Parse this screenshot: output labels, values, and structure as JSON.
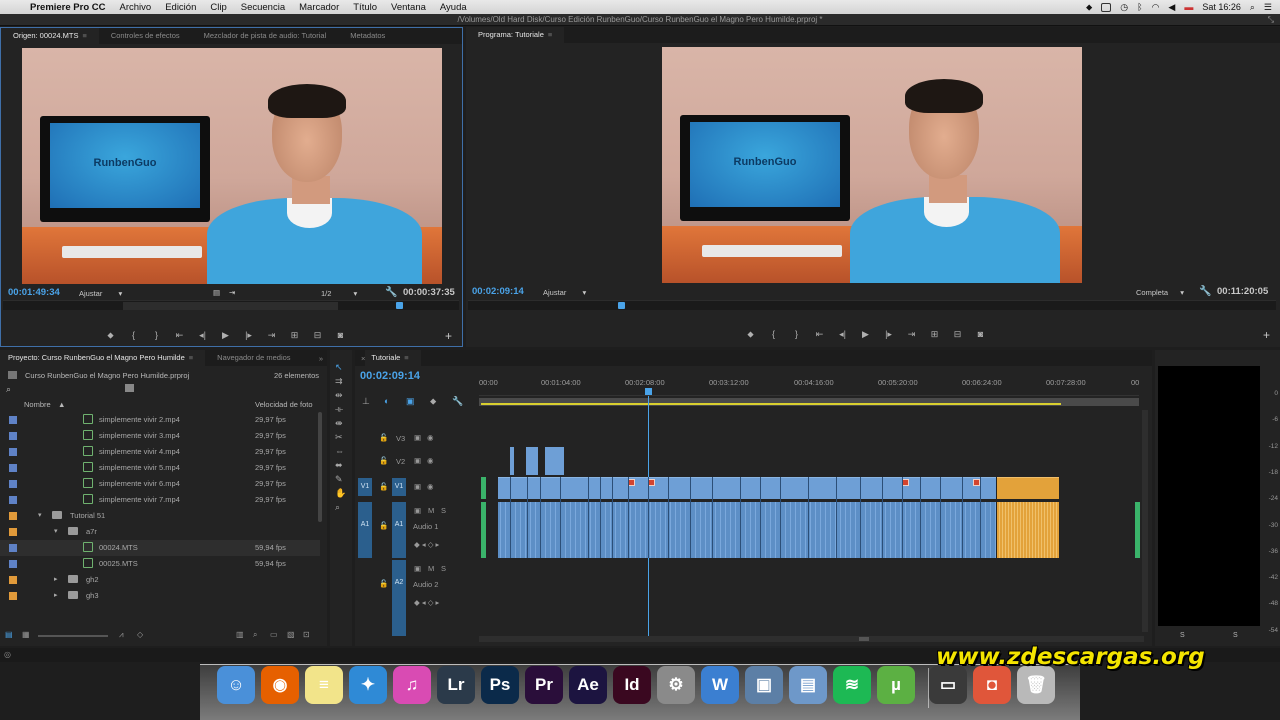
{
  "menubar": {
    "app": "Premiere Pro CC",
    "items": [
      "Archivo",
      "Edición",
      "Clip",
      "Secuencia",
      "Marcador",
      "Título",
      "Ventana",
      "Ayuda"
    ],
    "clock": "Sat 16:26"
  },
  "window": {
    "path": "/Volumes/Old Hard Disk/Curso Edición RunbenGuo/Curso RunbenGuo el Magno Pero Humilde.prproj *"
  },
  "source_monitor": {
    "tabs": [
      "Origen: 00024.MTS",
      "Controles de efectos",
      "Mezclador de pista de audio: Tutorial",
      "Metadatos"
    ],
    "screen_logo": "RunbenGuo",
    "timecode": "00:01:49:34",
    "fit": "Ajustar",
    "resolution": "1/2",
    "duration": "00:00:37:35"
  },
  "program_monitor": {
    "tab": "Programa: Tutoriale",
    "screen_logo": "RunbenGuo",
    "timecode": "00:02:09:14",
    "fit": "Ajustar",
    "quality": "Completa",
    "duration": "00:11:20:05"
  },
  "project": {
    "tabs": [
      "Proyecto: Curso RunbenGuo el Magno Pero Humilde",
      "Navegador de medios"
    ],
    "file": "Curso RunbenGuo el Magno Pero Humilde.prproj",
    "count": "26 elementos",
    "col_name": "Nombre",
    "col_fps": "Velocidad de foto",
    "rows": [
      {
        "name": "simplemente vivir 2.mp4",
        "fps": "29,97 fps",
        "indent": 3,
        "kind": "file",
        "label": "#5f82c6"
      },
      {
        "name": "simplemente vivir 3.mp4",
        "fps": "29,97 fps",
        "indent": 3,
        "kind": "file",
        "label": "#5f82c6"
      },
      {
        "name": "simplemente vivir 4.mp4",
        "fps": "29,97 fps",
        "indent": 3,
        "kind": "file",
        "label": "#5f82c6"
      },
      {
        "name": "simplemente vivir 5.mp4",
        "fps": "29,97 fps",
        "indent": 3,
        "kind": "file",
        "label": "#5f82c6"
      },
      {
        "name": "simplemente vivir 6.mp4",
        "fps": "29,97 fps",
        "indent": 3,
        "kind": "file",
        "label": "#5f82c6"
      },
      {
        "name": "simplemente vivir 7.mp4",
        "fps": "29,97 fps",
        "indent": 3,
        "kind": "file",
        "label": "#5f82c6"
      },
      {
        "name": "Tutorial 51",
        "fps": "",
        "indent": 1,
        "kind": "folder-open",
        "label": "#e19a3a"
      },
      {
        "name": "a7r",
        "fps": "",
        "indent": 2,
        "kind": "folder-open",
        "label": "#e19a3a"
      },
      {
        "name": "00024.MTS",
        "fps": "59,94 fps",
        "indent": 3,
        "kind": "file",
        "label": "#5f82c6"
      },
      {
        "name": "00025.MTS",
        "fps": "59,94 fps",
        "indent": 3,
        "kind": "file",
        "label": "#5f82c6"
      },
      {
        "name": "gh2",
        "fps": "",
        "indent": 2,
        "kind": "folder",
        "label": "#e19a3a"
      },
      {
        "name": "gh3",
        "fps": "",
        "indent": 2,
        "kind": "folder",
        "label": "#e19a3a"
      }
    ]
  },
  "timeline": {
    "tab": "Tutoriale",
    "timecode": "00:02:09:14",
    "ruler": [
      "00:00",
      "00:01:04:00",
      "00:02:08:00",
      "00:03:12:00",
      "00:04:16:00",
      "00:05:20:00",
      "00:06:24:00",
      "00:07:28:00",
      "00"
    ],
    "tracks": {
      "v3": "V3",
      "v2": "V2",
      "v1": "V1",
      "v1_src": "V1",
      "a1": "A1",
      "a1_src": "A1",
      "a1_name": "Audio 1",
      "a2": "A2",
      "a2_name": "Audio 2",
      "m": "M",
      "s": "S"
    }
  },
  "meters": {
    "scale": [
      "0",
      "-6",
      "-12",
      "-18",
      "-24",
      "-30",
      "-36",
      "-42",
      "-48",
      "-54"
    ],
    "solo": [
      "S",
      "S"
    ]
  },
  "dock": {
    "apps": [
      {
        "name": "Finder",
        "glyph": "☺",
        "color": "#4a90d9"
      },
      {
        "name": "Firefox",
        "glyph": "◉",
        "color": "#e66000"
      },
      {
        "name": "Stickies",
        "glyph": "≡",
        "color": "#f2e48a"
      },
      {
        "name": "Safari",
        "glyph": "✦",
        "color": "#2f8ad6"
      },
      {
        "name": "iTunes",
        "glyph": "♫",
        "color": "#d94bb3"
      },
      {
        "name": "Lightroom",
        "glyph": "Lr",
        "color": "#2b3a4a"
      },
      {
        "name": "Photoshop",
        "glyph": "Ps",
        "color": "#0b2a4a"
      },
      {
        "name": "Premiere",
        "glyph": "Pr",
        "color": "#2a0e3a"
      },
      {
        "name": "After Effects",
        "glyph": "Ae",
        "color": "#1c1440"
      },
      {
        "name": "InDesign",
        "glyph": "Id",
        "color": "#3a0820"
      },
      {
        "name": "System Preferences",
        "glyph": "⚙",
        "color": "#8a8a8a"
      },
      {
        "name": "Word",
        "glyph": "W",
        "color": "#3b7fd1"
      },
      {
        "name": "iPhoto",
        "glyph": "▣",
        "color": "#5c7fa6"
      },
      {
        "name": "Preview",
        "glyph": "▤",
        "color": "#6e98c9"
      },
      {
        "name": "Spotify",
        "glyph": "≋",
        "color": "#1db954"
      },
      {
        "name": "uTorrent",
        "glyph": "µ",
        "color": "#5cb043"
      },
      {
        "name": "Screen",
        "glyph": "▭",
        "color": "#3a3a3a"
      },
      {
        "name": "Photo Booth",
        "glyph": "◘",
        "color": "#e0563a"
      },
      {
        "name": "Trash",
        "glyph": "🗑",
        "color": "#b9b9b9"
      }
    ],
    "watermark": "www.zdescargas.org"
  }
}
